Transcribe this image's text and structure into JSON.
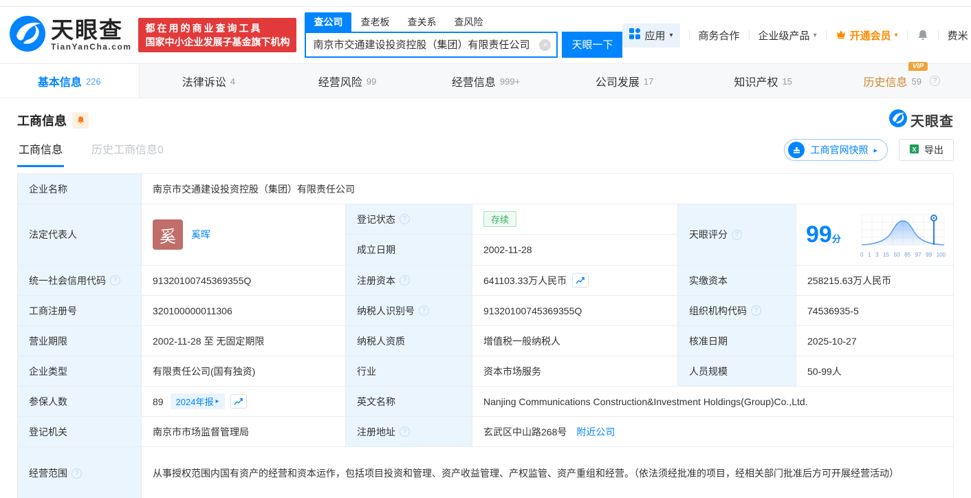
{
  "glyphs": {
    "caret": "▾",
    "arrow": "▸",
    "close": "×",
    "help": "?",
    "vip": "VIP"
  },
  "colors": {
    "brand_blue": "#0084ff",
    "vip_orange": "#ff8a00",
    "banner_red": "#e23a3a",
    "status_green": "#2bb55a"
  },
  "brand": {
    "logo_text": "天眼查",
    "logo_domain": "TianYanCha.com",
    "slogan_line1": "都在用的商业查询工具",
    "slogan_line2": "国家中小企业发展子基金旗下机构"
  },
  "search": {
    "tabs": [
      {
        "label": "查公司"
      },
      {
        "label": "查老板"
      },
      {
        "label": "查关系"
      },
      {
        "label": "查风险"
      }
    ],
    "value": "南京市交通建设投资控股（集团）有限责任公司",
    "button": "天眼一下"
  },
  "header_menu": {
    "apps": "应用",
    "business": "商务合作",
    "enterprise": "企业级产品",
    "vip": "开通会员",
    "user": "费米"
  },
  "nav_tabs": [
    {
      "label": "基本信息",
      "count": "226"
    },
    {
      "label": "法律诉讼",
      "count": "4"
    },
    {
      "label": "经营风险",
      "count": "99"
    },
    {
      "label": "经营信息",
      "count": "999+"
    },
    {
      "label": "公司发展",
      "count": "17"
    },
    {
      "label": "知识产权",
      "count": "15"
    },
    {
      "label": "历史信息",
      "count": "59"
    }
  ],
  "section": {
    "title": "工商信息",
    "watermark": "天眼查"
  },
  "subtabs": {
    "current": "工商信息",
    "history": "历史工商信息0",
    "snapshot_button": "工商官网快照",
    "export_button": "导出"
  },
  "table": {
    "company_name": {
      "label": "企业名称",
      "value": "南京市交通建设投资控股（集团）有限责任公司"
    },
    "legal_rep": {
      "label": "法定代表人",
      "avatar": "奚",
      "name": "奚晖"
    },
    "reg_status": {
      "label": "登记状态",
      "value": "存续"
    },
    "establish_date": {
      "label": "成立日期",
      "value": "2002-11-28"
    },
    "score": {
      "label": "天眼评分",
      "value": "99",
      "unit": "分",
      "ticks": [
        "0",
        "1",
        "3",
        "15",
        "50",
        "85",
        "97",
        "99",
        "100"
      ]
    },
    "credit_code": {
      "label": "统一社会信用代码",
      "value": "91320100745369355Q"
    },
    "reg_capital": {
      "label": "注册资本",
      "value": "641103.33万人民币"
    },
    "paid_capital": {
      "label": "实缴资本",
      "value": "258215.63万人民币"
    },
    "reg_number": {
      "label": "工商注册号",
      "value": "320100000011306"
    },
    "taxpayer_id": {
      "label": "纳税人识别号",
      "value": "91320100745369355Q"
    },
    "org_code": {
      "label": "组织机构代码",
      "value": "74536935-5"
    },
    "business_term": {
      "label": "营业期限",
      "value": "2002-11-28 至 无固定期限"
    },
    "taxpayer_quality": {
      "label": "纳税人资质",
      "value": "增值税一般纳税人"
    },
    "approval_date": {
      "label": "核准日期",
      "value": "2025-10-27"
    },
    "company_type": {
      "label": "企业类型",
      "value": "有限责任公司(国有独资)"
    },
    "industry": {
      "label": "行业",
      "value": "资本市场服务"
    },
    "staff_size": {
      "label": "人员规模",
      "value": "50-99人"
    },
    "insured_count": {
      "label": "参保人数",
      "value": "89",
      "tag": "2024年报"
    },
    "english_name": {
      "label": "英文名称",
      "value": "Nanjing Communications Construction&Investment Holdings(Group)Co.,Ltd."
    },
    "reg_authority": {
      "label": "登记机关",
      "value": "南京市市场监督管理局"
    },
    "reg_address": {
      "label": "注册地址",
      "value": "玄武区中山路268号",
      "nearby_link": "附近公司"
    },
    "business_scope": {
      "label": "经营范围",
      "value": "从事授权范围内国有资产的经营和资本运作，包括项目投资和管理、资产收益管理、产权监管、资产重组和经营。（依法须经批准的项目，经相关部门批准后方可开展经营活动）"
    }
  }
}
